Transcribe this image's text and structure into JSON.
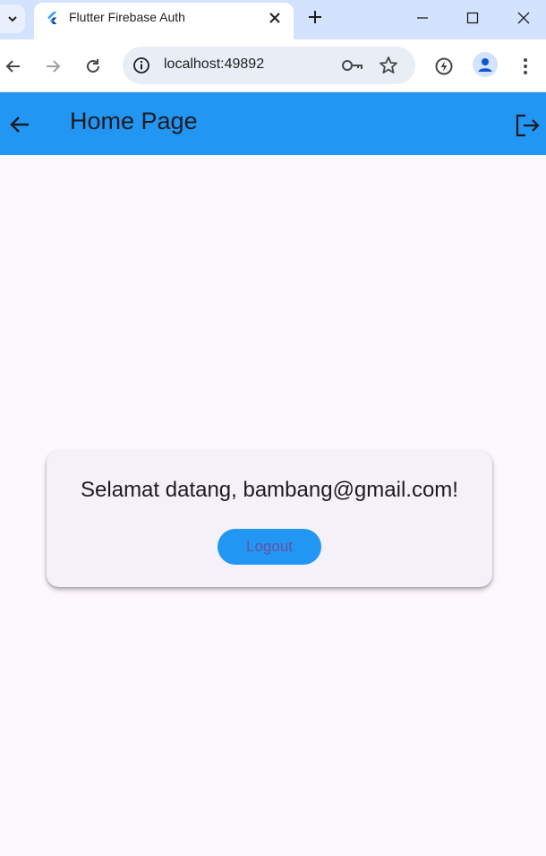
{
  "browser": {
    "tab": {
      "title": "Flutter Firebase Auth",
      "favicon": "flutter-logo-icon"
    },
    "address_bar": {
      "url": "localhost:49892"
    },
    "icons": {
      "tab_list": "chevron-down-icon",
      "tab_close": "close-icon",
      "new_tab": "plus-icon",
      "minimize": "minimize-icon",
      "maximize": "maximize-icon",
      "close_window": "close-icon",
      "back": "arrow-left-icon",
      "forward": "arrow-right-icon",
      "reload": "reload-icon",
      "site_info": "info-icon",
      "password": "key-icon",
      "bookmark": "star-icon",
      "performance": "leaf-icon",
      "profile": "person-icon",
      "menu": "more-vert-icon"
    },
    "colors": {
      "tabstrip": "#d3e3fd",
      "omnibox": "#e9eef6"
    }
  },
  "app": {
    "appbar": {
      "title": "Home Page",
      "back_icon": "arrow-left-icon",
      "action_icon": "logout-icon"
    },
    "card": {
      "welcome_text": "Selamat datang, bambang@gmail.com!",
      "logout_label": "Logout"
    },
    "colors": {
      "appbar": "#2196f3",
      "background": "#fdf7fe",
      "card": "#f4f1f8",
      "button": "#2196f3",
      "button_text": "#6750a4"
    }
  }
}
